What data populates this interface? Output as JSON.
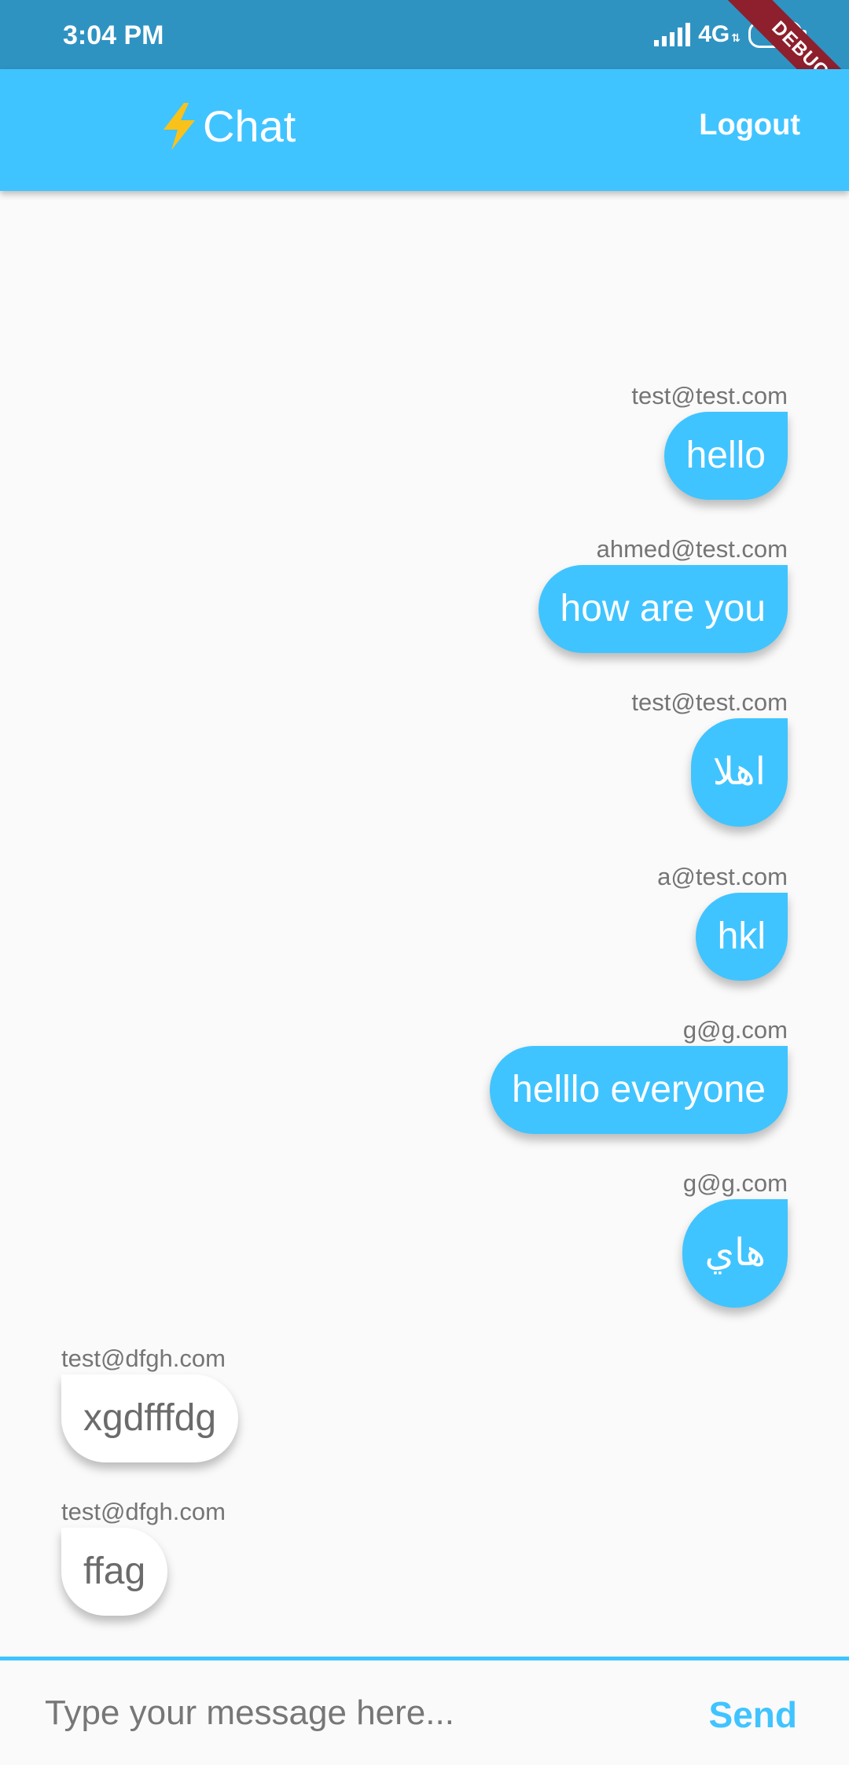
{
  "status_bar": {
    "time": "3:04 PM",
    "network": "4G",
    "battery": "90",
    "debug": "DEBUG"
  },
  "app_bar": {
    "title_icon": "lightning-bolt-icon",
    "title": "Chat",
    "logout_label": "Logout"
  },
  "messages": [
    {
      "sender": "test@test.com",
      "text": "hello",
      "side": "right"
    },
    {
      "sender": "ahmed@test.com",
      "text": "how are you",
      "side": "right"
    },
    {
      "sender": "test@test.com",
      "text": "اهلا",
      "side": "right"
    },
    {
      "sender": "a@test.com",
      "text": "hkl",
      "side": "right"
    },
    {
      "sender": "g@g.com",
      "text": "helllo everyone",
      "side": "right"
    },
    {
      "sender": "g@g.com",
      "text": "هاي",
      "side": "right"
    },
    {
      "sender": "test@dfgh.com",
      "text": "xgdfffdg",
      "side": "left"
    },
    {
      "sender": "test@dfgh.com",
      "text": "ffag",
      "side": "left"
    }
  ],
  "composer": {
    "placeholder": "Type your message here...",
    "send_label": "Send"
  },
  "colors": {
    "accent": "#40c4ff",
    "status_bar": "#2f93c2",
    "background": "#fafafa"
  }
}
